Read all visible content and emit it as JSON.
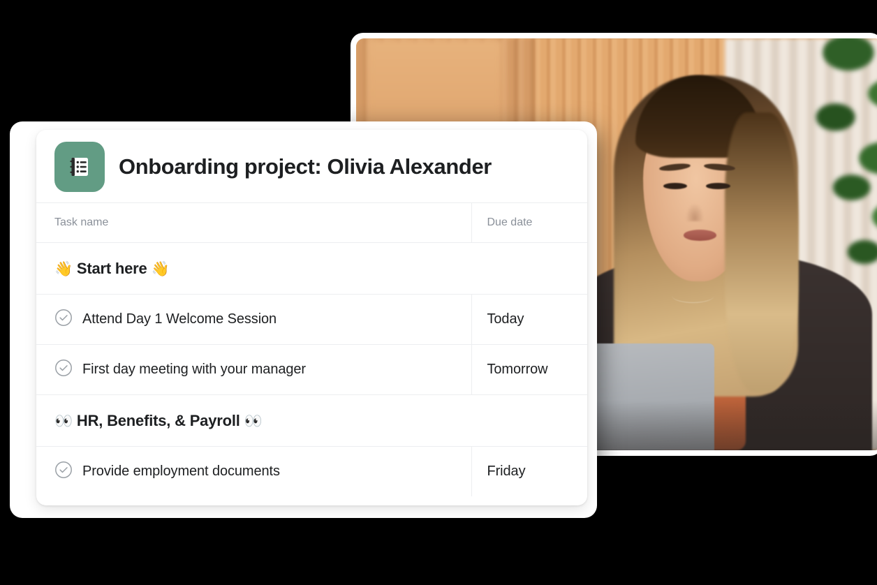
{
  "photo": {
    "alt_description": "Woman with long blonde-highlighted hair working on a laptop in a modern office with a wood slat wall and a plant",
    "frame_color": "#ffffff"
  },
  "card": {
    "project_icon": {
      "name": "notebook-list-icon",
      "background": "#629c84",
      "foreground": "#ffffff"
    },
    "title": "Onboarding project: Olivia Alexander",
    "columns": {
      "task_name": "Task name",
      "due_date": "Due date"
    },
    "accent_today_color": "#2d7d5b",
    "rows": [
      {
        "type": "section",
        "emoji_left": "👋",
        "label": "Start here",
        "emoji_right": "👋"
      },
      {
        "type": "task",
        "check": "check-circle-icon",
        "label": "Attend Day 1 Welcome Session",
        "due_date": "Today",
        "due_highlight": true
      },
      {
        "type": "task",
        "check": "check-circle-icon",
        "label": "First day meeting with your manager",
        "due_date": "Tomorrow",
        "due_highlight": false
      },
      {
        "type": "section",
        "emoji_left": "👀",
        "label": "HR, Benefits, & Payroll",
        "emoji_right": "👀"
      },
      {
        "type": "task",
        "check": "check-circle-icon",
        "label": "Provide employment documents",
        "due_date": "Friday",
        "due_highlight": false
      }
    ]
  }
}
